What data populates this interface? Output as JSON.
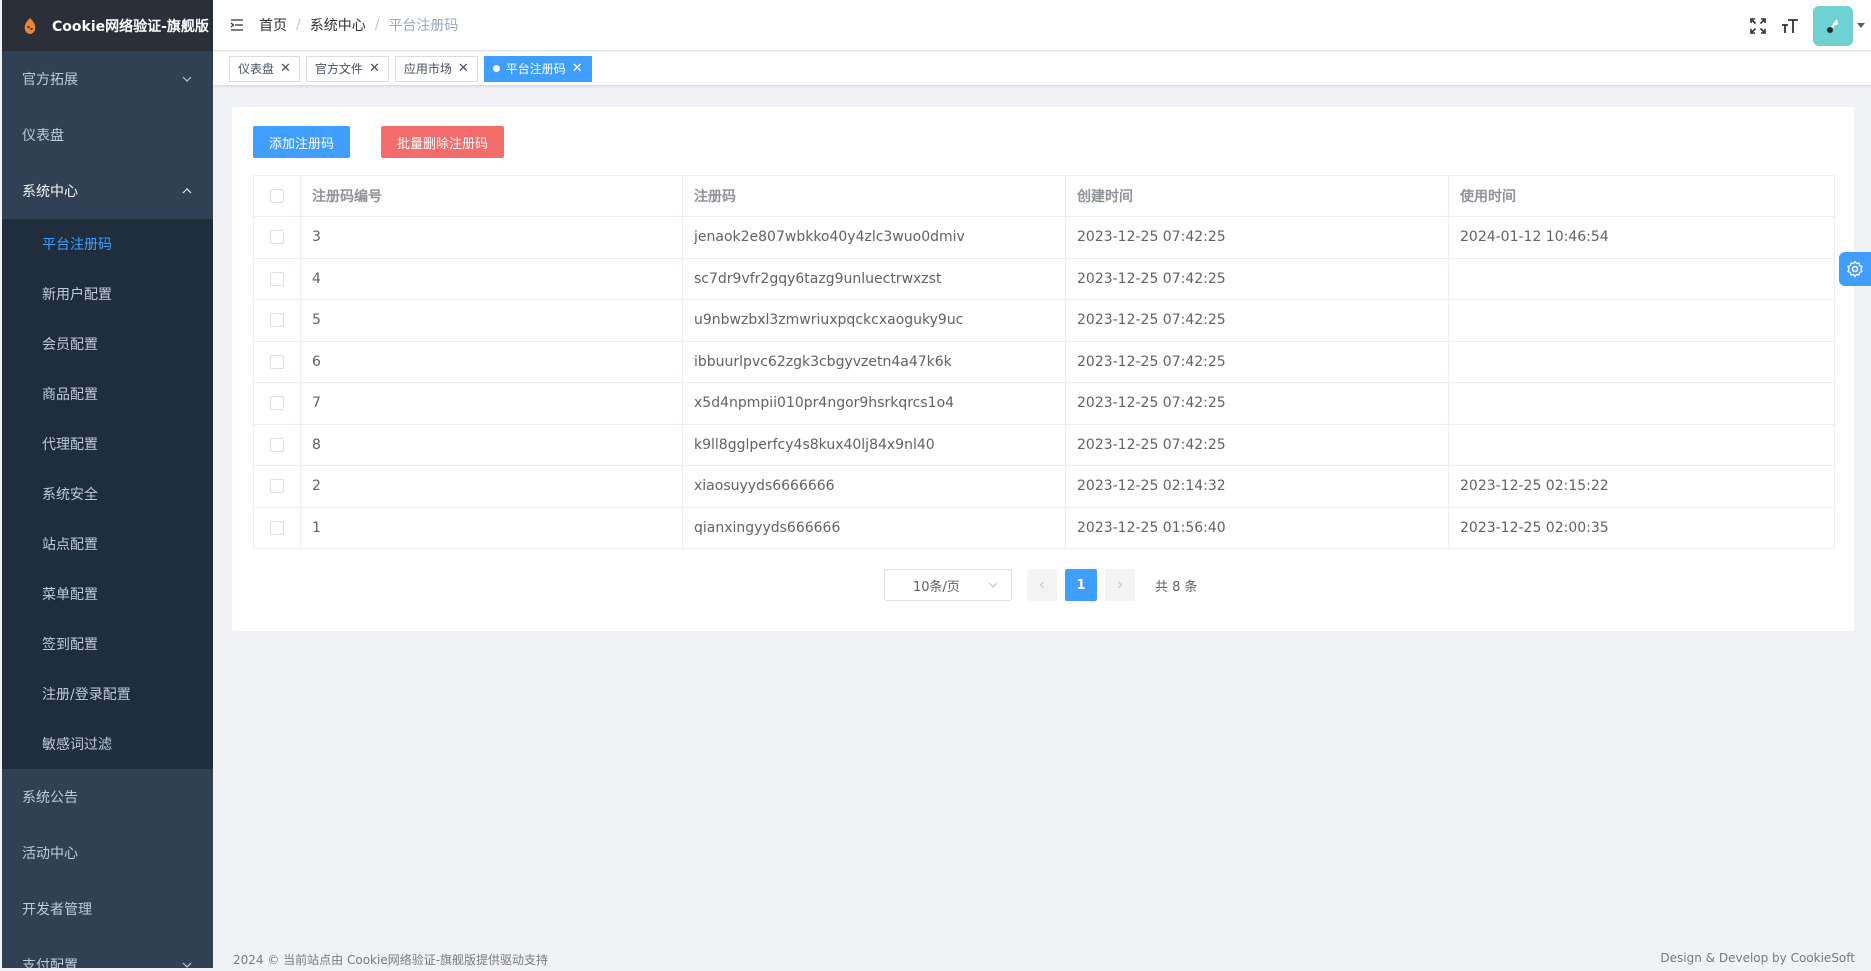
{
  "sidebar": {
    "title": "Cookie网络验证-旗舰版",
    "items_top": [
      {
        "label": "官方拓展"
      },
      {
        "label": "仪表盘"
      },
      {
        "label": "系统中心"
      }
    ],
    "submenu": [
      {
        "label": "平台注册码"
      },
      {
        "label": "新用户配置"
      },
      {
        "label": "会员配置"
      },
      {
        "label": "商品配置"
      },
      {
        "label": "代理配置"
      },
      {
        "label": "系统安全"
      },
      {
        "label": "站点配置"
      },
      {
        "label": "菜单配置"
      },
      {
        "label": "签到配置"
      },
      {
        "label": "注册/登录配置"
      },
      {
        "label": "敏感词过滤"
      }
    ],
    "items_bottom": [
      {
        "label": "系统公告"
      },
      {
        "label": "活动中心"
      },
      {
        "label": "开发者管理"
      },
      {
        "label": "支付配置"
      }
    ]
  },
  "breadcrumb": [
    "首页",
    "/",
    "系统中心",
    "/",
    "平台注册码"
  ],
  "tags": [
    {
      "label": "仪表盘"
    },
    {
      "label": "官方文件"
    },
    {
      "label": "应用市场"
    },
    {
      "label": "平台注册码"
    }
  ],
  "buttons": {
    "add": "添加注册码",
    "batch_delete": "批量删除注册码"
  },
  "table": {
    "headers": [
      "注册码编号",
      "注册码",
      "创建时间",
      "使用时间"
    ],
    "rows": [
      [
        "3",
        "jenaok2e807wbkko40y4zlc3wuo0dmiv",
        "2023-12-25 07:42:25",
        "2024-01-12 10:46:54"
      ],
      [
        "4",
        "sc7dr9vfr2gqy6tazg9unluectrwxzst",
        "2023-12-25 07:42:25",
        ""
      ],
      [
        "5",
        "u9nbwzbxl3zmwriuxpqckcxaoguky9uc",
        "2023-12-25 07:42:25",
        ""
      ],
      [
        "6",
        "ibbuurlpvc62zgk3cbgyvzetn4a47k6k",
        "2023-12-25 07:42:25",
        ""
      ],
      [
        "7",
        "x5d4npmpii010pr4ngor9hsrkqrcs1o4",
        "2023-12-25 07:42:25",
        ""
      ],
      [
        "8",
        "k9ll8gglperfcy4s8kux40lj84x9nl40",
        "2023-12-25 07:42:25",
        ""
      ],
      [
        "2",
        "xiaosuyyds6666666",
        "2023-12-25 02:14:32",
        "2023-12-25 02:15:22"
      ],
      [
        "1",
        "qianxingyyds666666",
        "2023-12-25 01:56:40",
        "2023-12-25 02:00:35"
      ]
    ]
  },
  "pagination": {
    "page_size": "10条/页",
    "current_page": "1",
    "total": "共 8 条"
  },
  "footer": {
    "left": "2024 © 当前站点由 Cookie网络验证-旗舰版提供驱动支持",
    "right": "Design & Develop by CookieSoft"
  },
  "colors": {
    "primary": "#409eff",
    "danger": "#f56c6c",
    "sidebar_bg": "#304156",
    "submenu_bg": "#1f2d3d",
    "avatar_bg": "#6fd1d2"
  }
}
